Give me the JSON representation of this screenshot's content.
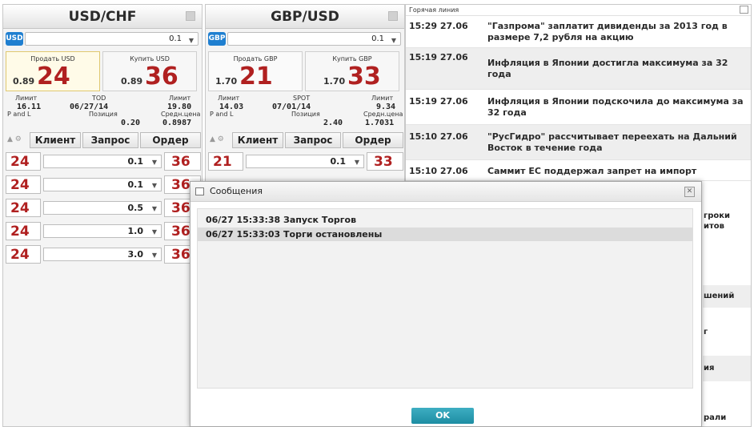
{
  "widgets": [
    {
      "pair": "USD/CHF",
      "ccy_badge": "USD",
      "quantity": "0.1",
      "sell_label": "Продать USD",
      "buy_label": "Купить USD",
      "sell_small": "0.89",
      "sell_big": "24",
      "buy_small": "0.89",
      "buy_big": "36",
      "limit_left_label": "Лимит",
      "value_date_type": "TOD",
      "limit_right_label": "Лимит",
      "limit_left": "16.11",
      "value_date": "06/27/14",
      "limit_right": "19.80",
      "pl_label": "P and L",
      "position_label": "Позиция",
      "avg_price_label": "Средн.цена",
      "position": "0.20",
      "avg_price": "0.8987",
      "pl": "",
      "tabs": [
        "Клиент",
        "Запрос",
        "Ордер"
      ],
      "quotes": [
        {
          "bid": "24",
          "qty": "0.1",
          "ask": "36"
        },
        {
          "bid": "24",
          "qty": "0.1",
          "ask": "36"
        },
        {
          "bid": "24",
          "qty": "0.5",
          "ask": "36"
        },
        {
          "bid": "24",
          "qty": "1.0",
          "ask": "36"
        },
        {
          "bid": "24",
          "qty": "3.0",
          "ask": "36"
        }
      ]
    },
    {
      "pair": "GBP/USD",
      "ccy_badge": "GBP",
      "quantity": "0.1",
      "sell_label": "Продать GBP",
      "buy_label": "Купить GBP",
      "sell_small": "1.70",
      "sell_big": "21",
      "buy_small": "1.70",
      "buy_big": "33",
      "limit_left_label": "Лимит",
      "value_date_type": "SPOT",
      "limit_right_label": "Лимит",
      "limit_left": "14.03",
      "value_date": "07/01/14",
      "limit_right": "9.34",
      "pl_label": "P and L",
      "position_label": "Позиция",
      "avg_price_label": "Средн.цена",
      "position": "2.40",
      "avg_price": "1.7031",
      "pl": "",
      "tabs": [
        "Клиент",
        "Запрос",
        "Ордер"
      ],
      "quotes": [
        {
          "bid": "21",
          "qty": "0.1",
          "ask": "33"
        }
      ]
    }
  ],
  "news": {
    "header": "Горячая линия",
    "items": [
      {
        "time": "15:29 27.06",
        "text": "\"Газпрома\" заплатит дивиденды за 2013 год в размере 7,2 рубля на акцию"
      },
      {
        "time": "15:19 27.06",
        "text": "Инфляция в Японии достигла максимума за 32 года"
      },
      {
        "time": "15:19 27.06",
        "text": "Инфляция в Японии подскочила до максимума за 32 года"
      },
      {
        "time": "15:10 27.06",
        "text": "\"РусГидро\" рассчитывает переехать на Дальний Восток в течение года"
      },
      {
        "time": "15:10 27.06",
        "text": "Саммит ЕС поддержал запрет на импорт"
      }
    ],
    "partial_fragments": [
      "гроки",
      "итов",
      "шений",
      "г",
      "ия",
      "рали"
    ]
  },
  "dialog": {
    "title": "Сообщения",
    "messages": [
      "06/27 15:33:38 Запуск Торгов",
      "06/27 15:33:03 Торги остановлены"
    ],
    "ok_label": "OK"
  }
}
